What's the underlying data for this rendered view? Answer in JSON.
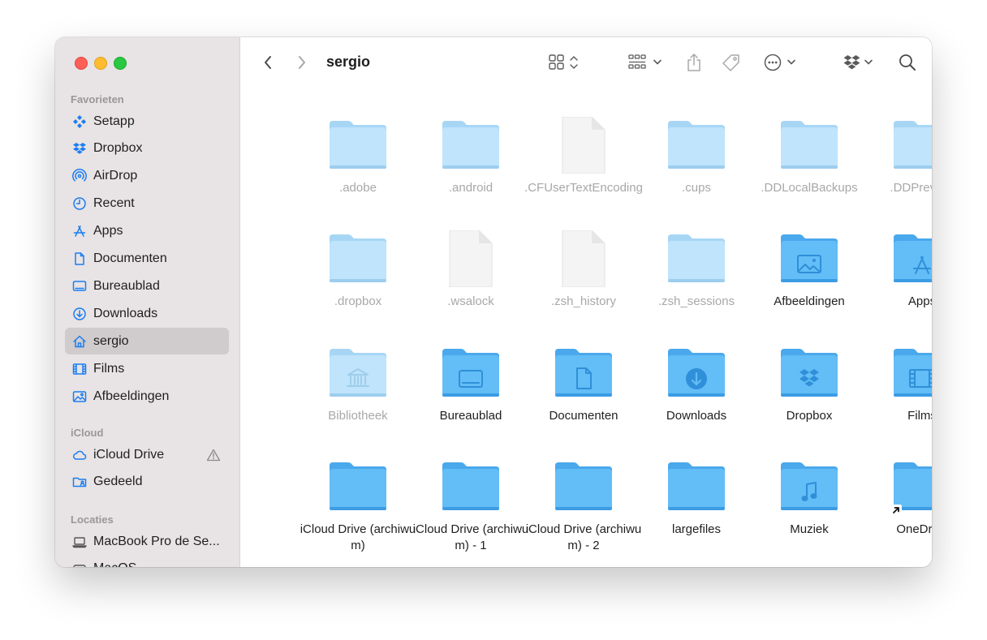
{
  "window": {
    "title": "sergio",
    "buttons": {
      "back_icon": "chevron-left",
      "forward_icon": "chevron-right",
      "view_icon": "grid",
      "group_icon": "group-by",
      "share_icon": "share",
      "tag_icon": "tag",
      "more_icon": "ellipsis-circle",
      "dropbox_icon": "dropbox",
      "search_icon": "magnifier"
    }
  },
  "sidebar": {
    "favorites_header": "Favorieten",
    "favorites": [
      {
        "label": "Setapp",
        "icon": "setapp"
      },
      {
        "label": "Dropbox",
        "icon": "dropbox"
      },
      {
        "label": "AirDrop",
        "icon": "airdrop"
      },
      {
        "label": "Recent",
        "icon": "clock"
      },
      {
        "label": "Apps",
        "icon": "apps"
      },
      {
        "label": "Documenten",
        "icon": "document"
      },
      {
        "label": "Bureaublad",
        "icon": "desktop"
      },
      {
        "label": "Downloads",
        "icon": "download"
      },
      {
        "label": "sergio",
        "icon": "home",
        "selected": true
      },
      {
        "label": "Films",
        "icon": "film"
      },
      {
        "label": "Afbeeldingen",
        "icon": "photo"
      }
    ],
    "icloud_header": "iCloud",
    "icloud": [
      {
        "label": "iCloud Drive",
        "icon": "cloud",
        "warning": true
      },
      {
        "label": "Gedeeld",
        "icon": "shared-folder"
      }
    ],
    "locations_header": "Locaties",
    "locations": [
      {
        "label": "MacBook Pro de Se...",
        "icon": "laptop"
      },
      {
        "label": "MacOS",
        "icon": "disk"
      }
    ]
  },
  "files": [
    {
      "name": ".adobe",
      "type": "folder",
      "hidden": true
    },
    {
      "name": ".android",
      "type": "folder",
      "hidden": true
    },
    {
      "name": ".CFUserTextEncoding",
      "type": "document",
      "hidden": true
    },
    {
      "name": ".cups",
      "type": "folder",
      "hidden": true
    },
    {
      "name": ".DDLocalBackups",
      "type": "folder",
      "hidden": true
    },
    {
      "name": ".DDPreview",
      "type": "folder",
      "hidden": true
    },
    {
      "name": ".dropbox",
      "type": "folder",
      "hidden": true
    },
    {
      "name": ".wsalock",
      "type": "document",
      "hidden": true
    },
    {
      "name": ".zsh_history",
      "type": "document",
      "hidden": true
    },
    {
      "name": ".zsh_sessions",
      "type": "folder",
      "hidden": true
    },
    {
      "name": "Afbeeldingen",
      "type": "folder",
      "glyph": "photo"
    },
    {
      "name": "Apps",
      "type": "folder",
      "glyph": "apps"
    },
    {
      "name": "Bibliotheek",
      "type": "folder",
      "glyph": "library",
      "hidden": true
    },
    {
      "name": "Bureaublad",
      "type": "folder",
      "glyph": "desktop"
    },
    {
      "name": "Documenten",
      "type": "folder",
      "glyph": "document"
    },
    {
      "name": "Downloads",
      "type": "folder",
      "glyph": "download"
    },
    {
      "name": "Dropbox",
      "type": "folder",
      "glyph": "dropbox"
    },
    {
      "name": "Films",
      "type": "folder",
      "glyph": "film"
    },
    {
      "name": "iCloud Drive (archiwum)",
      "type": "folder"
    },
    {
      "name": "iCloud Drive (archiwum) - 1",
      "type": "folder"
    },
    {
      "name": "iCloud Drive (archiwum) - 2",
      "type": "folder"
    },
    {
      "name": "largefiles",
      "type": "folder"
    },
    {
      "name": "Muziek",
      "type": "folder",
      "glyph": "music"
    },
    {
      "name": "OneDrive",
      "type": "folder",
      "alias": true
    }
  ],
  "colors": {
    "folder_light": "#bfe4fb",
    "folder_dark": "#63bdf6",
    "sidebar_icon": "#1a7ef1",
    "selected_row": "#d0cbcc"
  }
}
